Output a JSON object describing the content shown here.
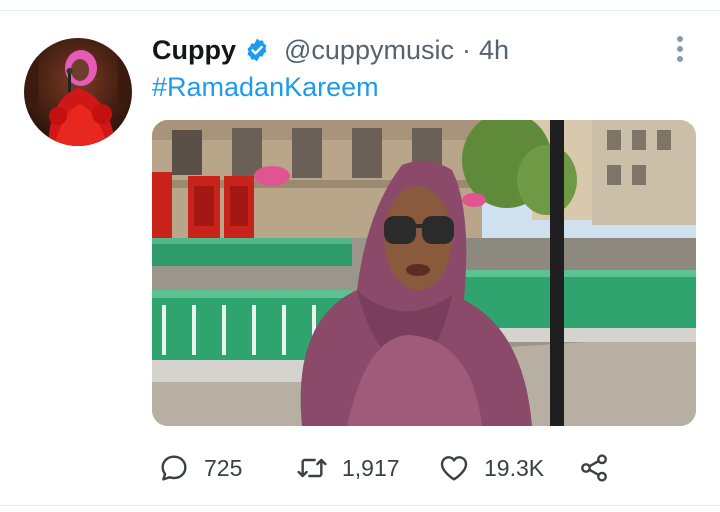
{
  "tweet": {
    "author_name": "Cuppy",
    "handle": "@cuppymusic",
    "separator": "·",
    "time": "4h",
    "text": "#RamadanKareem"
  },
  "actions": {
    "replies": "725",
    "retweets": "1,917",
    "likes": "19.3K"
  },
  "colors": {
    "link": "#1d9bf0",
    "verified": "#1d9bf0",
    "name": "#14171a",
    "secondary": "#536471"
  },
  "icons": [
    "verified-badge-icon",
    "more-options-icon",
    "reply-icon",
    "retweet-icon",
    "like-icon",
    "share-icon"
  ]
}
